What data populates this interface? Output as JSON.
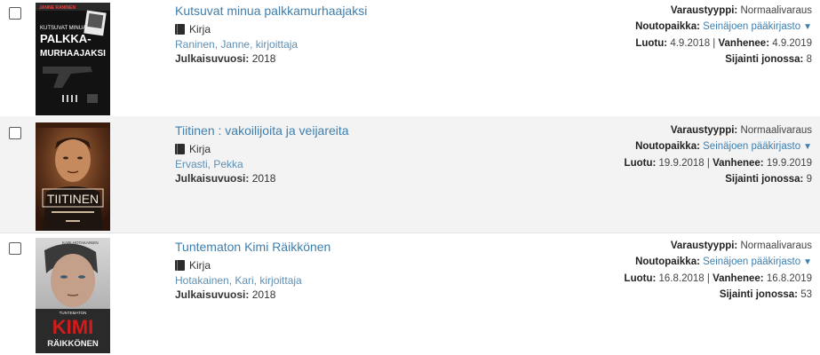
{
  "items": [
    {
      "title": "Kutsuvat minua palkkamurhaajaksi",
      "format": "Kirja",
      "author": "Raninen, Janne, kirjoittaja",
      "year_label": "Julkaisuvuosi:",
      "year": "2018",
      "cover_text_top": "JANNE RANINEN",
      "cover_text_mid": "KUTSUVAT MINUA",
      "cover_text_main1": "PALKKA-",
      "cover_text_main2": "MURHAAJAKSI",
      "reservation_type_label": "Varaustyyppi:",
      "reservation_type": "Normaalivaraus",
      "pickup_label": "Noutopaikka:",
      "pickup": "Seinäjoen pääkirjasto",
      "created_label": "Luotu:",
      "created": "4.9.2018",
      "separator": "|",
      "expires_label": "Vanhenee:",
      "expires": "4.9.2019",
      "queue_label": "Sijainti jonossa:",
      "queue": "8"
    },
    {
      "title": "Tiitinen : vakoilijoita ja veijareita",
      "format": "Kirja",
      "author": "Ervasti, Pekka",
      "year_label": "Julkaisuvuosi:",
      "year": "2018",
      "cover_text_main1": "TIITINEN",
      "reservation_type_label": "Varaustyyppi:",
      "reservation_type": "Normaalivaraus",
      "pickup_label": "Noutopaikka:",
      "pickup": "Seinäjoen pääkirjasto",
      "created_label": "Luotu:",
      "created": "19.9.2018",
      "separator": "|",
      "expires_label": "Vanhenee:",
      "expires": "19.9.2019",
      "queue_label": "Sijainti jonossa:",
      "queue": "9"
    },
    {
      "title": "Tuntematon Kimi Räikkönen",
      "format": "Kirja",
      "author": "Hotakainen, Kari, kirjoittaja",
      "year_label": "Julkaisuvuosi:",
      "year": "2018",
      "cover_text_top": "KARI HOTAKAINEN",
      "cover_text_mid": "TUNTEMATON",
      "cover_text_main1": "KIMI",
      "cover_text_main2": "RÄIKKÖNEN",
      "reservation_type_label": "Varaustyyppi:",
      "reservation_type": "Normaalivaraus",
      "pickup_label": "Noutopaikka:",
      "pickup": "Seinäjoen pääkirjasto",
      "created_label": "Luotu:",
      "created": "16.8.2018",
      "separator": "|",
      "expires_label": "Vanhenee:",
      "expires": "16.8.2019",
      "queue_label": "Sijainti jonossa:",
      "queue": "53"
    }
  ],
  "caret_glyph": "▼"
}
